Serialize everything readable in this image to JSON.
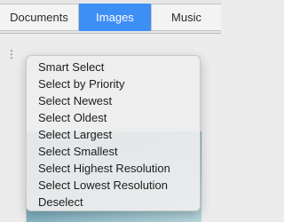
{
  "tabs": [
    {
      "label": "Documents"
    },
    {
      "label": "Images",
      "selected": true
    },
    {
      "label": "Music"
    }
  ],
  "colors": {
    "selected_tab": "#3d8ef5",
    "menu_background": "#eeeeee"
  },
  "menu": {
    "items": [
      {
        "label": "Smart Select"
      },
      {
        "label": "Select by Priority"
      },
      {
        "label": "Select Newest"
      },
      {
        "label": "Select Oldest"
      },
      {
        "label": "Select Largest"
      },
      {
        "label": "Select Smallest"
      },
      {
        "label": "Select Highest Resolution"
      },
      {
        "label": "Select Lowest Resolution"
      },
      {
        "label": "Deselect"
      }
    ]
  }
}
